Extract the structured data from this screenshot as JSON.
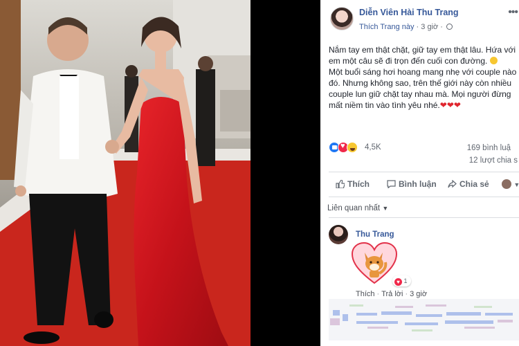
{
  "post": {
    "author": "Diễn Viên Hài Thu Trang",
    "meta_link": "Thích Trang này",
    "meta_sep": " · ",
    "time": "3 giờ",
    "paragraph_1": "Nắm tay em thật chặt, giữ tay em thật lâu. Hứa với em một câu sẽ đi trọn đến cuối con đường.",
    "paragraph_2": "Một buổi sáng hơi hoang mang nhẹ với couple nào đó. Nhưng không sao, trên thế giới này còn nhiều couple lun giữ chặt tay nhau mà. Mọi người đừng mất niềm tin vào tình yêu nhé.",
    "hearts": "❤❤❤"
  },
  "stats": {
    "reactions_count": "4,5K",
    "comments": "169 bình luậ",
    "shares": "12 lượt chia s"
  },
  "actions": {
    "like": "Thích",
    "comment": "Bình luận",
    "share": "Chia sẻ"
  },
  "comments_section": {
    "sort_label": "Liên quan nhất",
    "comment": {
      "author": "Thu Trang",
      "reaction_count": "1",
      "like": "Thích",
      "reply": "Trả lời",
      "time": "3 giờ"
    }
  },
  "icons": {
    "globe": "globe-icon",
    "menu": "more-dots-icon",
    "like": "thumbs-up-icon",
    "comment": "speech-bubble-icon",
    "share": "share-arrow-icon"
  },
  "colors": {
    "link": "#365899",
    "dress": "#d4151b",
    "carpet": "#c9261d",
    "like_blue": "#2078f4",
    "love_red": "#f0284a"
  }
}
